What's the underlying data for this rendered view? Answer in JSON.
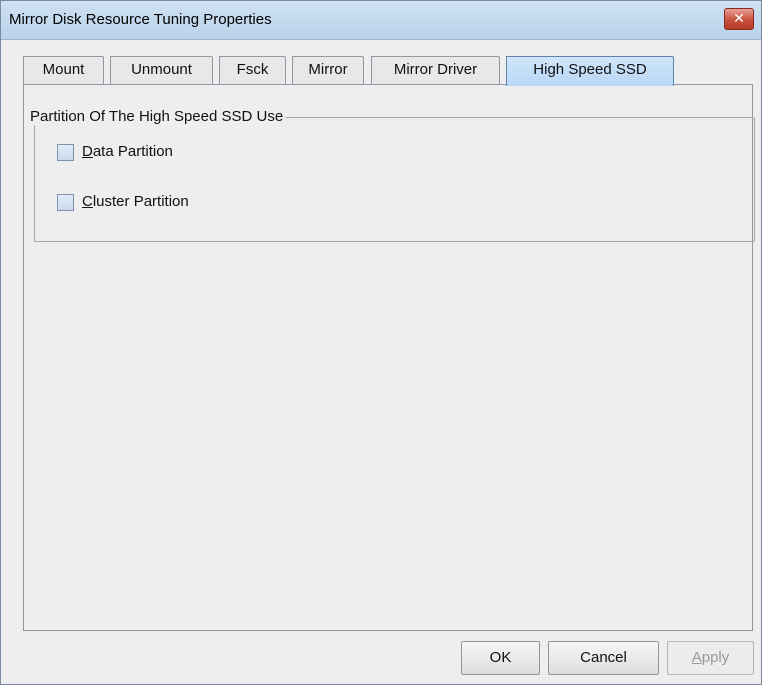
{
  "window": {
    "title": "Mirror Disk Resource Tuning Properties",
    "close_glyph": "✕"
  },
  "tabs": [
    {
      "label": "Mount",
      "active": false
    },
    {
      "label": "Unmount",
      "active": false
    },
    {
      "label": "Fsck",
      "active": false
    },
    {
      "label": "Mirror",
      "active": false
    },
    {
      "label": "Mirror Driver",
      "active": false
    },
    {
      "label": "High Speed SSD",
      "active": true
    }
  ],
  "group": {
    "title": "Partition Of The High Speed SSD Use",
    "options": [
      {
        "mnemonic": "D",
        "rest": "ata Partition",
        "checked": false
      },
      {
        "mnemonic": "C",
        "rest": "luster Partition",
        "checked": false
      }
    ]
  },
  "buttons": {
    "ok": "OK",
    "cancel": "Cancel",
    "apply_mnemonic": "A",
    "apply_rest": "pply",
    "apply_enabled": false
  },
  "colors": {
    "active_tab": "#b9d7f5",
    "close_button": "#c9503d"
  },
  "icons": {
    "close": "close-icon",
    "checkbox": "checkbox-unchecked-icon"
  }
}
